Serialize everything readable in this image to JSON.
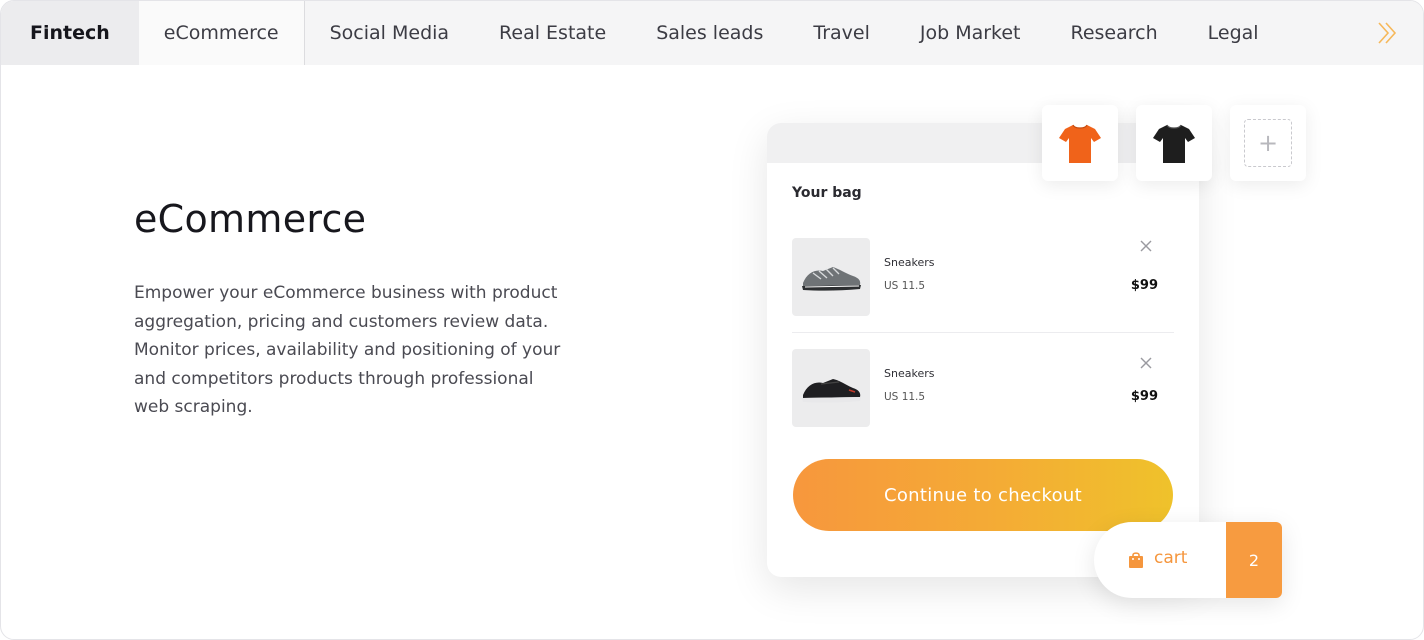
{
  "tabs": [
    {
      "label": "Fintech"
    },
    {
      "label": "eCommerce"
    },
    {
      "label": "Social Media"
    },
    {
      "label": "Real Estate"
    },
    {
      "label": "Sales leads"
    },
    {
      "label": "Travel"
    },
    {
      "label": "Job Market"
    },
    {
      "label": "Research"
    },
    {
      "label": "Legal"
    }
  ],
  "content": {
    "heading": "eCommerce",
    "description": "Empower your eCommerce business with product aggregation, pricing and customers review data. Monitor prices, availability and positioning of your and competitors products through professional web scraping."
  },
  "thumbnails": [
    {
      "icon": "orange-tshirt-icon",
      "color": "#f0631a"
    },
    {
      "icon": "black-tshirt-icon",
      "color": "#1e1e1e"
    },
    {
      "icon": "add-plus-icon"
    }
  ],
  "bag": {
    "title": "Your bag",
    "items": [
      {
        "name": "Sneakers",
        "size": "US 11.5",
        "price": "$99",
        "icon": "gray-sneaker-icon"
      },
      {
        "name": "Sneakers",
        "size": "US 11.5",
        "price": "$99",
        "icon": "black-sneaker-icon"
      }
    ],
    "checkout_label": "Continue to checkout"
  },
  "cart": {
    "label": "cart",
    "count": "2"
  },
  "colors": {
    "accent": "#f79b40",
    "gradient_start": "#f7973d",
    "gradient_end": "#efc22b"
  }
}
